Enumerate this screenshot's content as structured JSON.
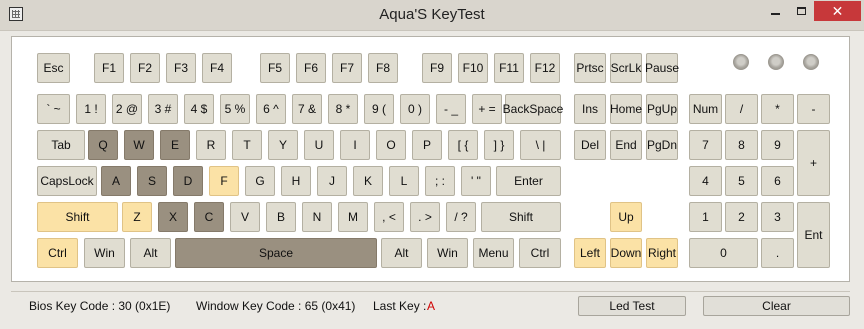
{
  "window": {
    "title": "Aqua'S KeyTest",
    "minimize_glyph": "",
    "maximize_glyph": "",
    "close_glyph": "✕"
  },
  "colors": {
    "panel_bg": "#ffffff",
    "key_default": "#e0ddd1",
    "key_pressed": "#9a9080",
    "key_highlight": "#fbe2a6",
    "last_key_color": "#d00000"
  },
  "keys": {
    "esc": "Esc",
    "f1": "F1",
    "f2": "F2",
    "f3": "F3",
    "f4": "F4",
    "f5": "F5",
    "f6": "F6",
    "f7": "F7",
    "f8": "F8",
    "f9": "F9",
    "f10": "F10",
    "f11": "F11",
    "f12": "F12",
    "prtsc": "Prtsc",
    "scrlk": "ScrLk",
    "pause": "Pause",
    "backtick": "` ~",
    "n1": "1 !",
    "n2": "2 @",
    "n3": "3 #",
    "n4": "4 $",
    "n5": "5 %",
    "n6": "6 ^",
    "n7": "7 &",
    "n8": "8 *",
    "n9": "9 (",
    "n0": "0 )",
    "minus": "- _",
    "equals": "+ =",
    "backspace": "BackSpace",
    "ins": "Ins",
    "home": "Home",
    "pgup": "PgUp",
    "numlock": "Num",
    "np_div": "/",
    "np_mul": "*",
    "np_minus": "-",
    "tab": "Tab",
    "q": "Q",
    "w": "W",
    "e": "E",
    "r": "R",
    "t": "T",
    "y": "Y",
    "u": "U",
    "i": "I",
    "o": "O",
    "p": "P",
    "lbracket": "[ {",
    "rbracket": "] }",
    "backslash": "\\ |",
    "del": "Del",
    "end": "End",
    "pgdn": "PgDn",
    "np7": "7",
    "np8": "8",
    "np9": "9",
    "np_plus": "+",
    "capslock": "CapsLock",
    "a": "A",
    "s": "S",
    "d": "D",
    "f": "F",
    "g": "G",
    "h": "H",
    "j": "J",
    "k": "K",
    "l": "L",
    "semicolon": "; :",
    "quote": "' \"",
    "enter": "Enter",
    "np4": "4",
    "np5": "5",
    "np6": "6",
    "lshift": "Shift",
    "z": "Z",
    "x": "X",
    "c": "C",
    "v": "V",
    "b": "B",
    "n": "N",
    "m": "M",
    "comma": ", <",
    "period": ". >",
    "slash": "/ ?",
    "rshift": "Shift",
    "up": "Up",
    "np1": "1",
    "np2": "2",
    "np3": "3",
    "np_enter": "Ent",
    "lctrl": "Ctrl",
    "lwin": "Win",
    "lalt": "Alt",
    "space": "Space",
    "ralt": "Alt",
    "rwin": "Win",
    "menu": "Menu",
    "rctrl": "Ctrl",
    "left": "Left",
    "down": "Down",
    "right": "Right",
    "np0": "0",
    "np_dot": "."
  },
  "key_states": {
    "pressed": [
      "q",
      "w",
      "e",
      "a",
      "s",
      "d",
      "x",
      "c",
      "space"
    ],
    "highlighted": [
      "f",
      "lshift",
      "z",
      "lctrl",
      "up",
      "left",
      "down",
      "right"
    ]
  },
  "status": {
    "bios_label": "Bios Key Code : 30 (0x1E)",
    "window_label": "Window Key Code : 65 (0x41)",
    "last_key_label": "Last Key :",
    "last_key_value": "A",
    "led_test_button": "Led Test",
    "clear_button": "Clear"
  }
}
